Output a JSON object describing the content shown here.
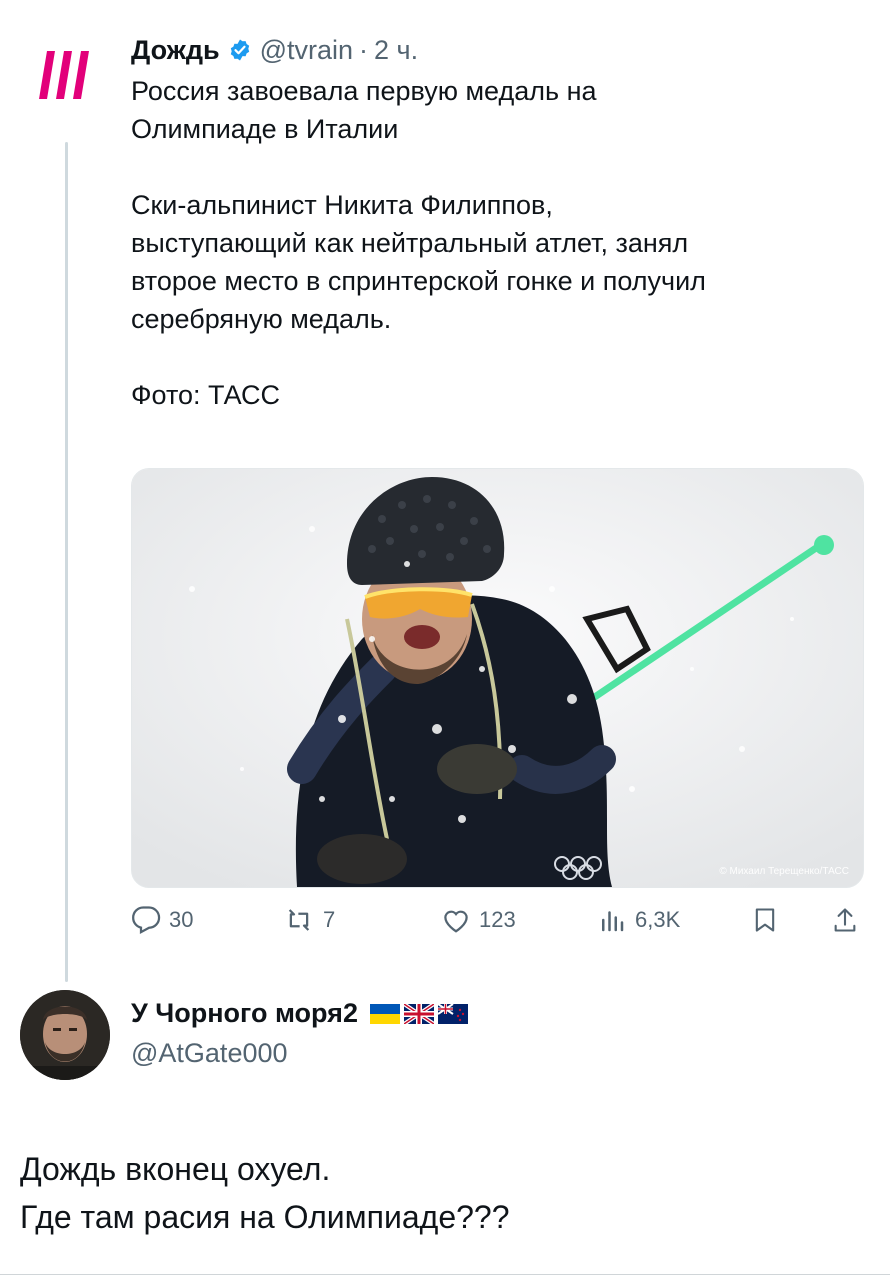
{
  "tweet": {
    "author_name": "Дождь",
    "author_handle": "@tvrain",
    "separator": "·",
    "time": "2 ч.",
    "text_lines": [
      "Россия завоевала первую медаль на",
      "Олимпиаде в Италии"
    ],
    "text_lines_2": [
      "Ски-альпинист Никита Филиппов,",
      "выступающий как нейтральный атлет, занял",
      "второе место в спринтерской гонке и получил",
      "серебряную медаль."
    ],
    "photo_caption": "Фото: ТАСС",
    "media_credit": "© Михаил Терещенко/ТАСС",
    "stats": {
      "replies": "30",
      "reposts": "7",
      "likes": "123",
      "views": "6,3K"
    }
  },
  "reply": {
    "author_name": "У Чорного моря2",
    "author_handle": "@AtGate000",
    "text_lines": [
      "Дождь вконец охуел.",
      "Где там расия на Олимпиаде???"
    ]
  },
  "colors": {
    "brand_rain": "#e2007a",
    "verified": "#1d9bf0",
    "muted": "#536471",
    "text": "#0f1419"
  },
  "icons": [
    "tvrain-logo-icon",
    "verified-badge-icon",
    "reply-icon",
    "repost-icon",
    "like-icon",
    "views-icon",
    "bookmark-icon",
    "share-icon"
  ]
}
